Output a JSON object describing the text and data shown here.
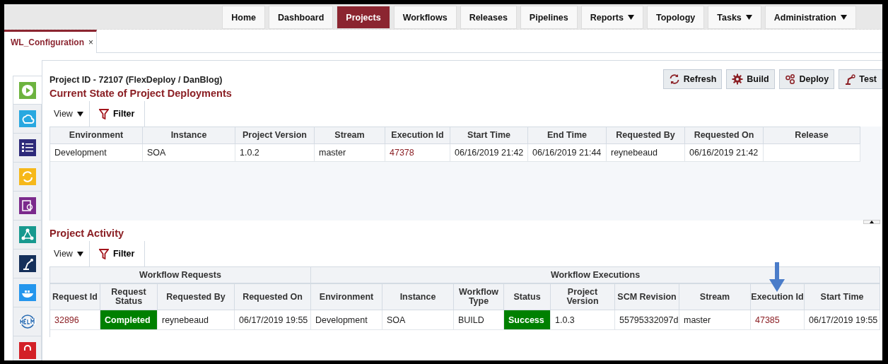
{
  "nav": [
    {
      "label": "Home",
      "selected": false,
      "dropdown": false
    },
    {
      "label": "Dashboard",
      "selected": false,
      "dropdown": false
    },
    {
      "label": "Projects",
      "selected": true,
      "dropdown": false
    },
    {
      "label": "Workflows",
      "selected": false,
      "dropdown": false
    },
    {
      "label": "Releases",
      "selected": false,
      "dropdown": false
    },
    {
      "label": "Pipelines",
      "selected": false,
      "dropdown": false
    },
    {
      "label": "Reports",
      "selected": false,
      "dropdown": true
    },
    {
      "label": "Topology",
      "selected": false,
      "dropdown": false
    },
    {
      "label": "Tasks",
      "selected": false,
      "dropdown": true
    },
    {
      "label": "Administration",
      "selected": false,
      "dropdown": true
    }
  ],
  "tabs": [
    {
      "label": "WL_Configuration",
      "close": "×",
      "selected": true
    }
  ],
  "sidebar": {
    "items": [
      {
        "kind": "gear-play",
        "selected": true
      },
      {
        "kind": "cloud",
        "selected": false
      },
      {
        "kind": "list",
        "selected": false
      },
      {
        "kind": "sync",
        "selected": false
      },
      {
        "kind": "clipboard",
        "selected": false
      },
      {
        "kind": "network",
        "selected": false
      },
      {
        "kind": "robot",
        "selected": false
      },
      {
        "kind": "whale",
        "selected": false
      },
      {
        "kind": "helm",
        "selected": false
      },
      {
        "kind": "lock",
        "selected": false
      }
    ]
  },
  "project_title": "Project ID - 72107 (FlexDeploy / DanBlog)",
  "actions": [
    {
      "kind": "refresh",
      "label": "Refresh"
    },
    {
      "kind": "build",
      "label": "Build"
    },
    {
      "kind": "deploy",
      "label": "Deploy"
    },
    {
      "kind": "test",
      "label": "Test"
    }
  ],
  "deployments": {
    "heading": "Current State of Project Deployments",
    "toolbar": {
      "view": "View",
      "filter": "Filter"
    },
    "columns": [
      "Environment",
      "Instance",
      "Project Version",
      "Stream",
      "Execution Id",
      "Start Time",
      "End Time",
      "Requested By",
      "Requested On",
      "Release"
    ],
    "rows": [
      [
        {
          "kind": "text",
          "text": "Development"
        },
        {
          "kind": "text",
          "text": "SOA"
        },
        {
          "kind": "text",
          "text": "1.0.2"
        },
        {
          "kind": "text",
          "text": "master"
        },
        {
          "kind": "link",
          "text": "47378"
        },
        {
          "kind": "text",
          "text": "06/16/2019 21:42"
        },
        {
          "kind": "text",
          "text": "06/16/2019 21:44"
        },
        {
          "kind": "text",
          "text": "reynebeaud"
        },
        {
          "kind": "text",
          "text": "06/16/2019 21:42"
        },
        {
          "kind": "text",
          "text": ""
        }
      ]
    ]
  },
  "activity": {
    "heading": "Project Activity",
    "toolbar": {
      "view": "View",
      "filter": "Filter"
    },
    "groups": [
      "Workflow Requests",
      "Workflow Executions"
    ],
    "columns": [
      "Request Id",
      "Request Status",
      "Requested By",
      "Requested On",
      "Environment",
      "Instance",
      "Workflow Type",
      "Status",
      "Project Version",
      "SCM Revision",
      "Stream",
      "Execution Id",
      "Start Time"
    ],
    "rows": [
      [
        {
          "kind": "link",
          "text": "32896"
        },
        {
          "kind": "status",
          "text": "Completed",
          "color": "#008000"
        },
        {
          "kind": "text",
          "text": "reynebeaud"
        },
        {
          "kind": "text",
          "text": "06/17/2019 19:55"
        },
        {
          "kind": "text",
          "text": "Development"
        },
        {
          "kind": "text",
          "text": "SOA"
        },
        {
          "kind": "text",
          "text": "BUILD"
        },
        {
          "kind": "status",
          "text": "Success",
          "color": "#008000"
        },
        {
          "kind": "text",
          "text": "1.0.3"
        },
        {
          "kind": "text",
          "text": "55795332097d"
        },
        {
          "kind": "text",
          "text": "master"
        },
        {
          "kind": "link",
          "text": "47385"
        },
        {
          "kind": "text",
          "text": "06/17/2019 19:55"
        }
      ]
    ]
  }
}
